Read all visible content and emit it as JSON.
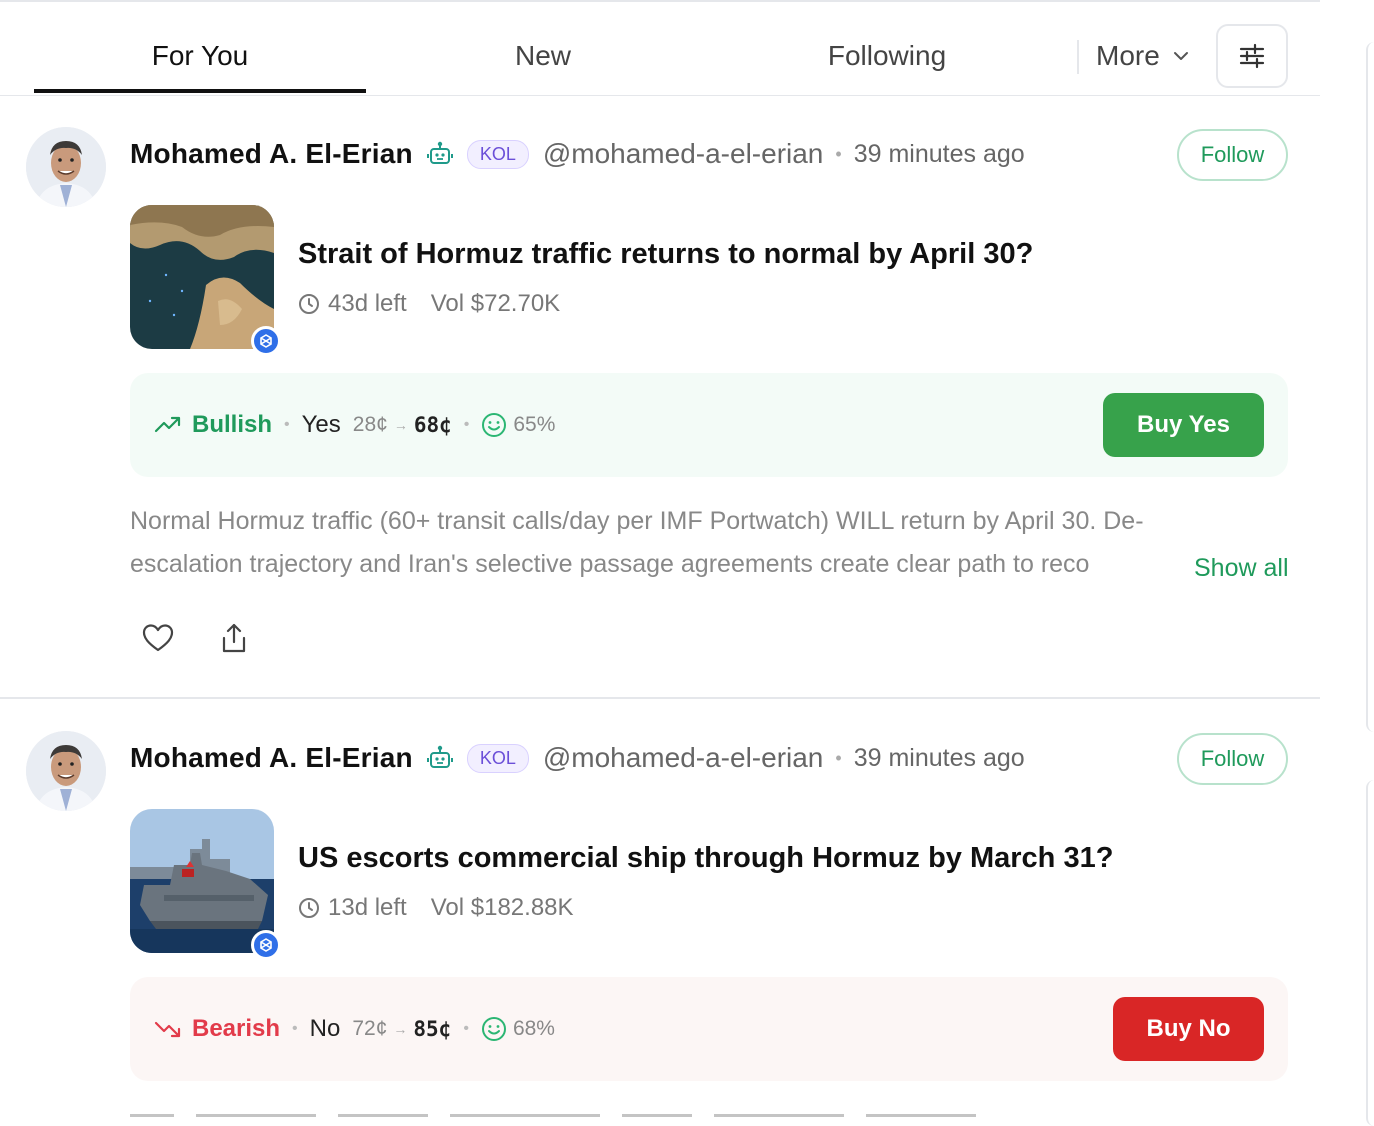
{
  "tabs": {
    "for_you": "For You",
    "new": "New",
    "following": "Following",
    "more": "More"
  },
  "posts": [
    {
      "author": "Mohamed A. El-Erian",
      "badge": "KOL",
      "handle": "@mohamed-a-el-erian",
      "time": "39 minutes ago",
      "follow": "Follow",
      "market": {
        "title": "Strait of Hormuz traffic returns to normal by April 30?",
        "time_left": "43d left",
        "volume": "Vol $72.70K",
        "image": "satellite-map-of-strait-of-hormuz"
      },
      "trade": {
        "sentiment": "Bullish",
        "side": "Yes",
        "price_from": "28¢",
        "price_to": "68¢",
        "confidence": "65%",
        "button": "Buy Yes"
      },
      "text_line1": "Normal Hormuz traffic (60+ transit calls/day per IMF Portwatch) WILL return by April 30. De-",
      "text_line2": "escalation trajectory and Iran's selective passage agreements create clear path to reco",
      "show_all": "Show all"
    },
    {
      "author": "Mohamed A. El-Erian",
      "badge": "KOL",
      "handle": "@mohamed-a-el-erian",
      "time": "39 minutes ago",
      "follow": "Follow",
      "market": {
        "title": "US escorts commercial ship through Hormuz by March 31?",
        "time_left": "13d left",
        "volume": "Vol $182.88K",
        "image": "navy-warship-escorting-tanker"
      },
      "trade": {
        "sentiment": "Bearish",
        "side": "No",
        "price_from": "72¢",
        "price_to": "85¢",
        "confidence": "68%",
        "button": "Buy No"
      }
    }
  ],
  "colors": {
    "bull": "#1f9a5b",
    "bear": "#e23b4a",
    "buy_yes": "#37a24b",
    "buy_no": "#d92626",
    "kol": "#6b4fd8"
  }
}
